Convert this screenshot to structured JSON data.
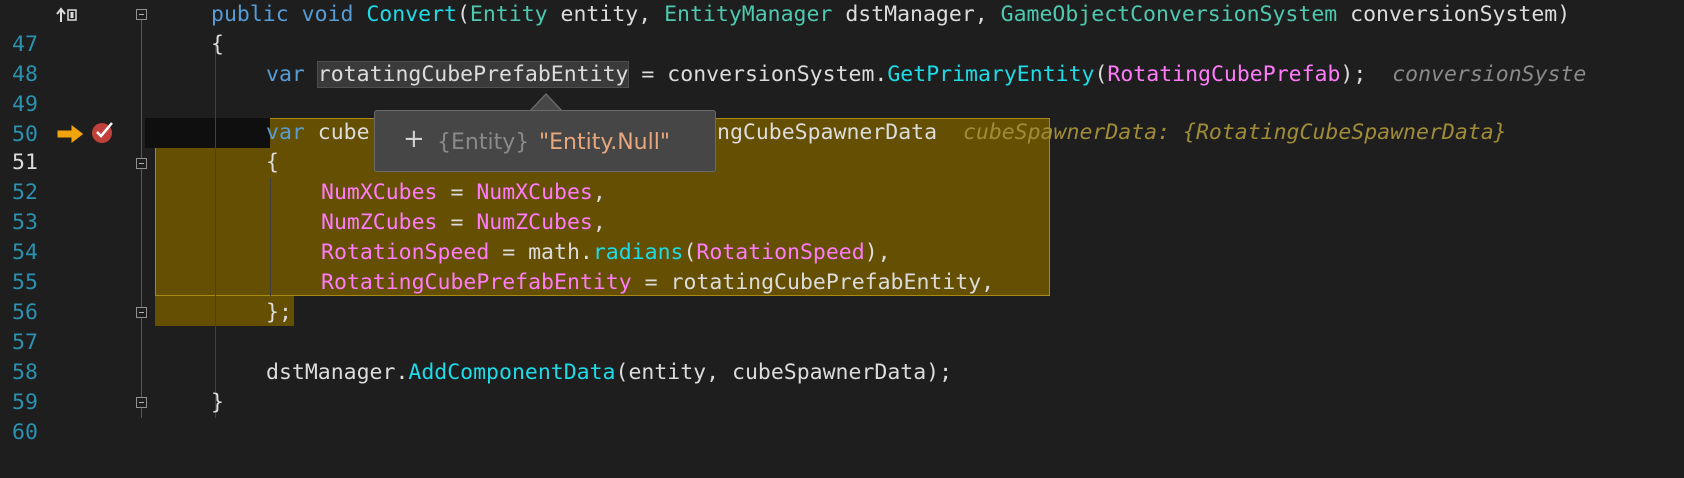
{
  "editor": {
    "lines": [
      {
        "n": "47"
      },
      {
        "n": "48"
      },
      {
        "n": "49"
      },
      {
        "n": "50"
      },
      {
        "n": "51"
      },
      {
        "n": "52"
      },
      {
        "n": "53"
      },
      {
        "n": "54"
      },
      {
        "n": "55"
      },
      {
        "n": "56"
      },
      {
        "n": "57"
      },
      {
        "n": "58"
      },
      {
        "n": "59"
      },
      {
        "n": "60"
      }
    ],
    "code": {
      "l47": {
        "kw1": "public",
        "kw2": "void",
        "method": "Convert",
        "p1": "(",
        "t1": "Entity",
        "p2": " entity, ",
        "t2": "EntityManager",
        "p3": " dstManager, ",
        "t3": "GameObjectConversionSystem",
        "p4": " conversionSystem)"
      },
      "l48": {
        "text": "{"
      },
      "l49": {
        "kw": "var",
        "var": "rotatingCubePrefabEntity",
        "p1": " = conversionSystem.",
        "method": "GetPrimaryEntity",
        "p2": "(",
        "field": "RotatingCubePrefab",
        "p3": ");",
        "hint": "conversionSyste"
      },
      "l51": {
        "kw": "var",
        "p1": " cube",
        "p2": "ngCubeSpawnerData",
        "hint": "cubeSpawnerData: {RotatingCubeSpawnerData}"
      },
      "l52": {
        "text": "{"
      },
      "l53": {
        "field1": "NumXCubes",
        "op": " = ",
        "field2": "NumXCubes",
        "end": ","
      },
      "l54": {
        "field1": "NumZCubes",
        "op": " = ",
        "field2": "NumZCubes",
        "end": ","
      },
      "l55": {
        "field1": "RotationSpeed",
        "op": " = math.",
        "method": "radians",
        "p": "(",
        "field2": "RotationSpeed",
        "end": "),"
      },
      "l56": {
        "field1": "RotatingCubePrefabEntity",
        "op": " = rotatingCubePrefabEntity",
        "end": ","
      },
      "l57": {
        "text": "};"
      },
      "l59": {
        "p1": "dstManager.",
        "method": "AddComponentData",
        "p2": "(entity, cubeSpawnerData);"
      },
      "l60": {
        "text": "}"
      }
    }
  },
  "tooltip": {
    "plus": "+",
    "type": "{Entity}",
    "value": "\"Entity.Null\""
  },
  "colors": {
    "background": "#1e1e1e",
    "keyword": "#569cd6",
    "method": "#1ddce8",
    "type": "#4ec9b0",
    "field": "#ff7bfa",
    "highlight": "#654f02",
    "line_number": "#2b91af"
  },
  "icons": {
    "execution_arrow": "current-statement-arrow-icon",
    "breakpoint": "breakpoint-icon",
    "bookmark": "bookmark-up-icon"
  }
}
